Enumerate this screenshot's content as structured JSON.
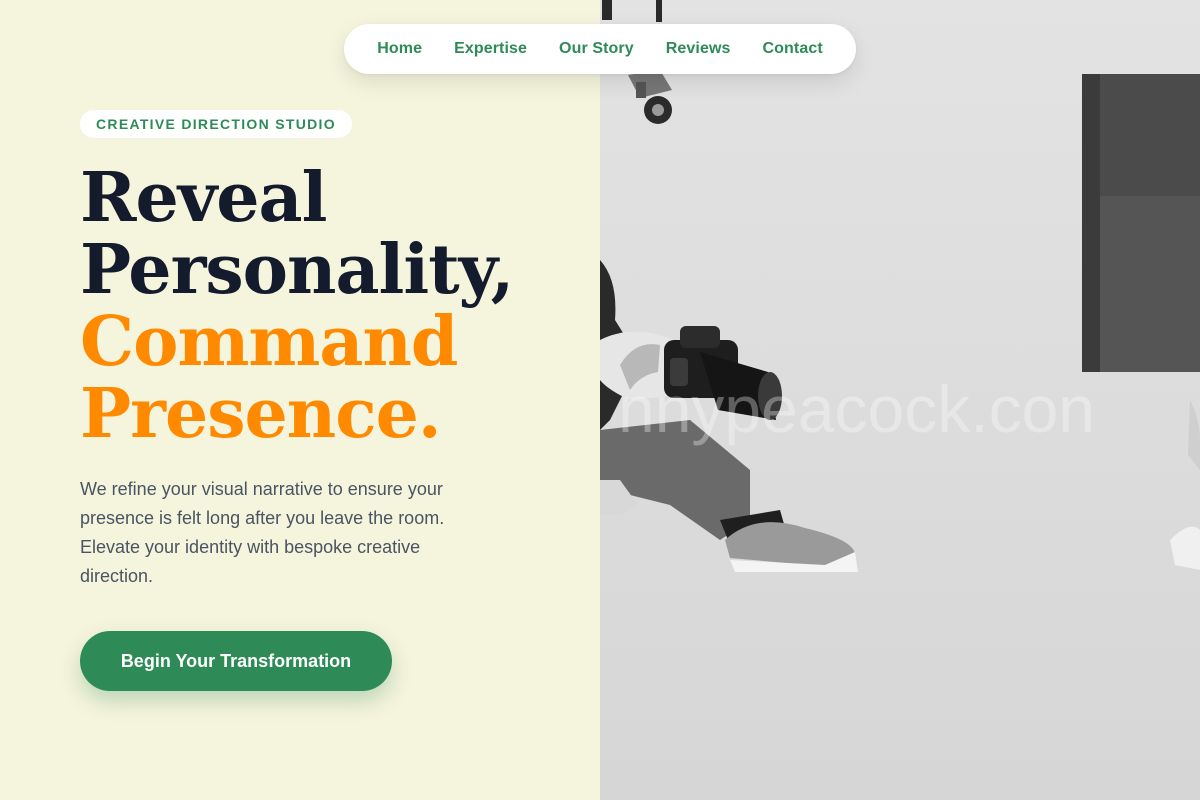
{
  "nav": {
    "items": [
      {
        "label": "Home"
      },
      {
        "label": "Expertise"
      },
      {
        "label": "Our Story"
      },
      {
        "label": "Reviews"
      },
      {
        "label": "Contact"
      }
    ]
  },
  "hero": {
    "badge": "CREATIVE DIRECTION STUDIO",
    "headline": {
      "line1": "Reveal",
      "line2": "Personality,",
      "line3": "Command",
      "line4": "Presence."
    },
    "description": "We refine your visual narrative to ensure your presence is felt long after you leave the room. Elevate your identity with bespoke creative direction.",
    "cta_label": "Begin Your Transformation"
  },
  "image": {
    "watermark": "nnypeacock.con",
    "subject": "grayscale photo of a photographer sitting on a studio floor holding a camera, with a dark box and equipment cart"
  },
  "colors": {
    "accent_green": "#2e8b57",
    "accent_orange": "#ff8a00",
    "headline_dark": "#141b2d",
    "left_background": "#f5f4dc",
    "body_text": "#4a5462"
  }
}
